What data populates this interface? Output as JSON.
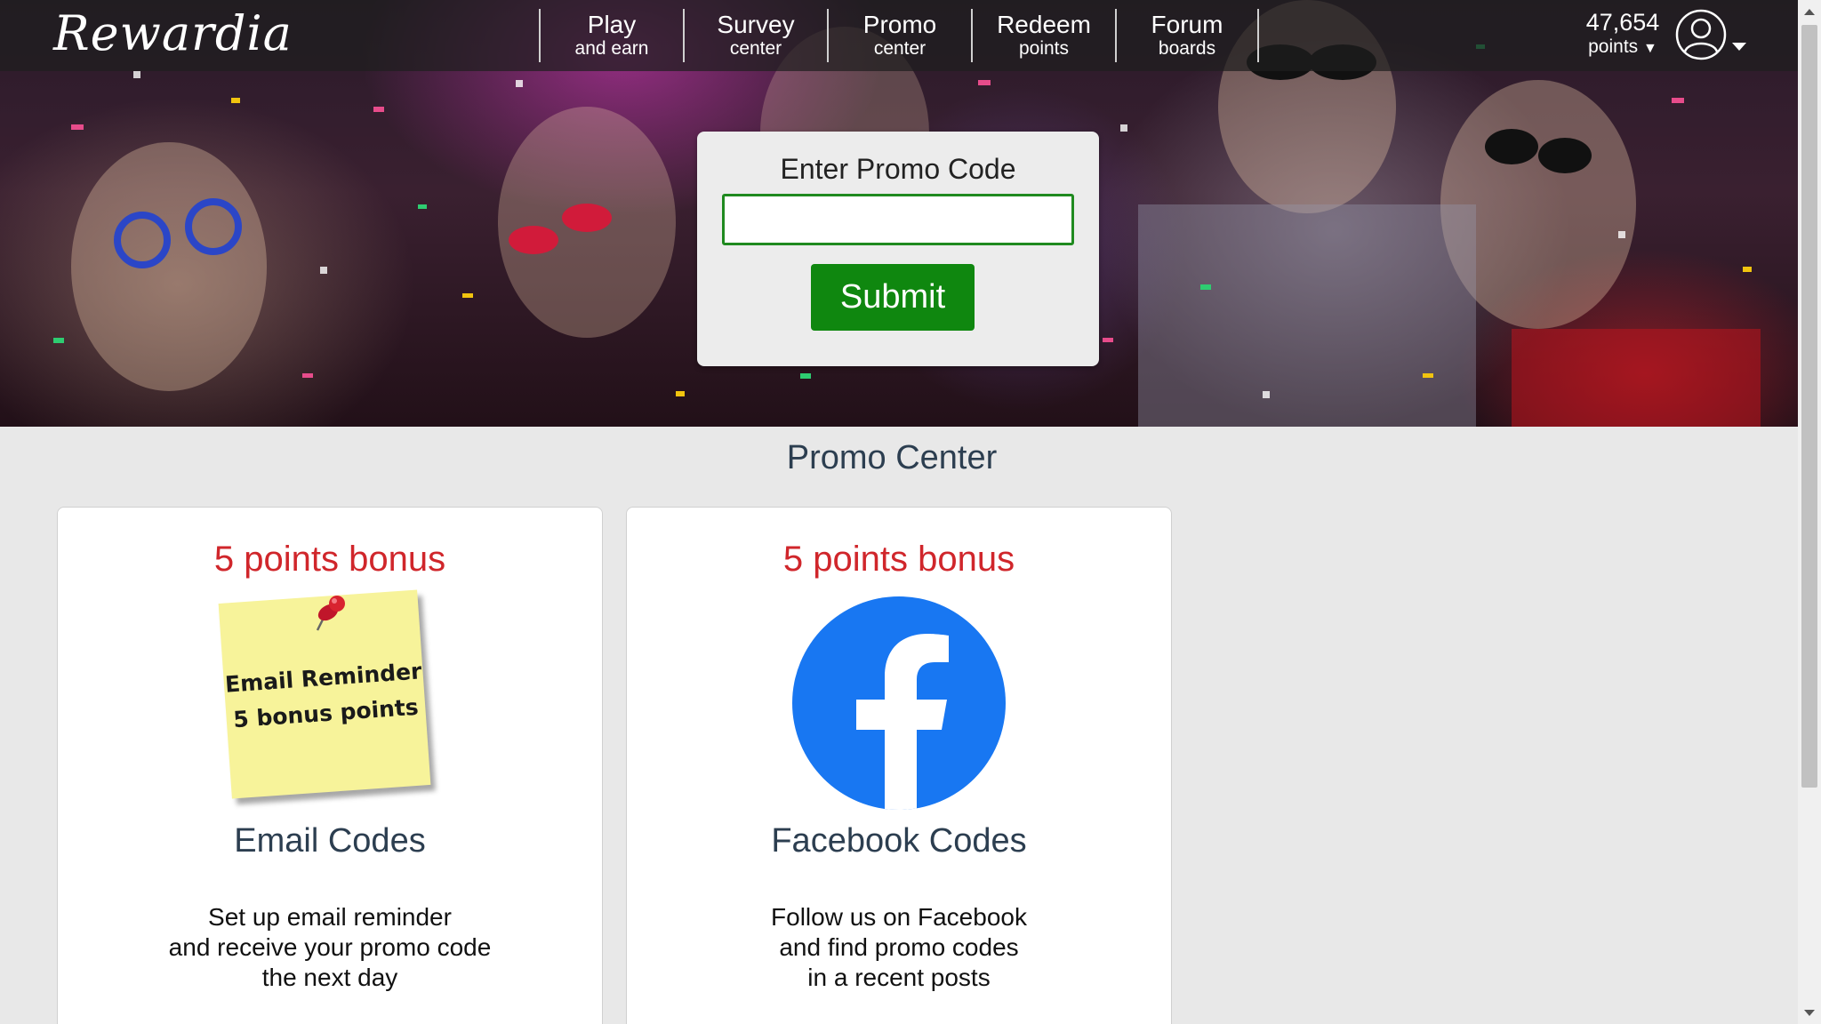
{
  "header": {
    "logo": "Rewardia",
    "nav": [
      {
        "main": "Play",
        "sub": "and earn"
      },
      {
        "main": "Survey",
        "sub": "center"
      },
      {
        "main": "Promo",
        "sub": "center"
      },
      {
        "main": "Redeem",
        "sub": "points"
      },
      {
        "main": "Forum",
        "sub": "boards"
      }
    ],
    "points_value": "47,654",
    "points_label": "points",
    "icons": {
      "user": "user-circle-icon",
      "dropdown": "caret-down-icon"
    }
  },
  "promo": {
    "title": "Enter Promo Code",
    "input_value": "",
    "submit_label": "Submit",
    "colors": {
      "input_border": "#1f8a1f",
      "submit_bg": "#0f870f"
    }
  },
  "section_title": "Promo Center",
  "cards": [
    {
      "bonus": "5 points bonus",
      "image_text_1": "Email Reminder",
      "image_text_2": "5 bonus points",
      "name": "Email Codes",
      "desc": [
        "Set up email reminder",
        "and receive your promo code",
        "the next day"
      ],
      "icon": "sticky-note-icon"
    },
    {
      "bonus": "5 points bonus",
      "name": "Facebook Codes",
      "desc": [
        "Follow us on Facebook",
        "and find promo codes",
        "in a recent posts"
      ],
      "icon": "facebook-logo-icon"
    }
  ],
  "colors": {
    "bonus": "#d0262b",
    "heading": "#2c3e50",
    "facebook": "#1877f2"
  }
}
